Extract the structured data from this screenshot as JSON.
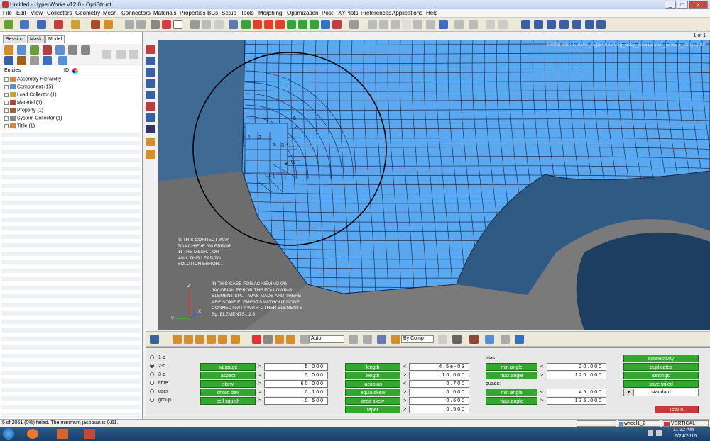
{
  "window": {
    "title": "Untitled - HyperWorks v12.0 - OptiStruct",
    "min": "_",
    "max": "□",
    "close": "x"
  },
  "menu": [
    "File",
    "Edit",
    "View",
    "Collectors",
    "Geometry",
    "Mesh",
    "Connectors",
    "Materials",
    "Properties",
    "BCs",
    "Setup",
    "Tools",
    "Morphing",
    "Optimization",
    "Post",
    "XYPlots",
    "Preferences",
    "Applications",
    "Help"
  ],
  "page_indicator": "1 of 1",
  "browser": {
    "tabs": [
      "Session",
      "Mask",
      "Model"
    ],
    "header_entities": "Entities",
    "header_id": "ID",
    "items": [
      "Assembly Hierarchy",
      "Component (15)",
      "Load Collector (1)",
      "Material (1)",
      "Property (1)",
      "System Collector (1)",
      "Titile (1)"
    ]
  },
  "viewport": {
    "model_info": "Model Info: C:/swtr_hypermeshing_assy_june11/swtr_june23_long1.hm*",
    "element_labels": [
      "1",
      "2",
      "3",
      "4",
      "5",
      "6",
      "7",
      "8",
      "9",
      "10"
    ],
    "annotation1": "IS THIS CORRECT WAY\nTO ACHIEVE 0% ERROR\nIN THE MESH....OR\nWILL THIS LEAD TO\nSOLUTION ERROR...",
    "annotation2": "IN THIS CASE FOR ACHIEVING 0%\nJACOBIAN ERROR THE FOLLOWING\nELEMENT SPLIT WAS MADE AND THERE\nARE SOME ELEMENTS WITHOUT NODE\nCONNECTIVITY WITH OTHER ELEMENTS\nEg: ELEMENTS1,2,3",
    "axis_x": "X",
    "axis_y": "Y",
    "axis_z": "Z"
  },
  "vp_toolbar": {
    "auto": "Auto",
    "bycomp": "By Comp"
  },
  "check": {
    "dims": [
      "1-d",
      "2-d",
      "3-d",
      "time",
      "user",
      "group"
    ],
    "selected_dim": "2-d",
    "col1": [
      {
        "label": "warpage",
        "value": "5.000"
      },
      {
        "label": "aspect",
        "value": "5.000"
      },
      {
        "label": "skew",
        "value": "60.000"
      },
      {
        "label": "chord dev",
        "value": "0.100"
      },
      {
        "label": "cell squish",
        "value": "0.500"
      }
    ],
    "col2": [
      {
        "label": "length",
        "op": "<",
        "value": "4.5e-03"
      },
      {
        "label": "length",
        "op": ">",
        "value": "10.000"
      },
      {
        "label": "jacobian",
        "op": "<",
        "value": "0.700"
      },
      {
        "label": "equia skew",
        "op": ">",
        "value": "0.600"
      },
      {
        "label": "area skew",
        "op": ">",
        "value": "0.600"
      },
      {
        "label": "taper",
        "op": ">",
        "value": "0.500"
      }
    ],
    "trias_label": "trias:",
    "trias": [
      {
        "label": "min angle",
        "op": "<",
        "value": "20.000"
      },
      {
        "label": "max angle",
        "op": ">",
        "value": "120.000"
      }
    ],
    "quads_label": "quads:",
    "quads": [
      {
        "label": "min angle",
        "op": "<",
        "value": "45.000"
      },
      {
        "label": "max angle",
        "op": ">",
        "value": "135.000"
      }
    ],
    "right_buttons": [
      "connectivity",
      "duplicates",
      "settings",
      "save failed"
    ],
    "standard": "standard",
    "return": "return"
  },
  "status": {
    "message": "5 of 2061 (0%) failed.  The minimum jacobian is 0.61.",
    "comp": "wheel1_2",
    "view": "VERTICAL"
  },
  "taskbar": {
    "time": "11:32 AM",
    "date": "6/24/2016"
  },
  "colors": {
    "mesh_fill": "#5aa9f0",
    "mesh_line": "#1b2f55",
    "green_button": "#33a82e",
    "return_button": "#c63a3a"
  }
}
